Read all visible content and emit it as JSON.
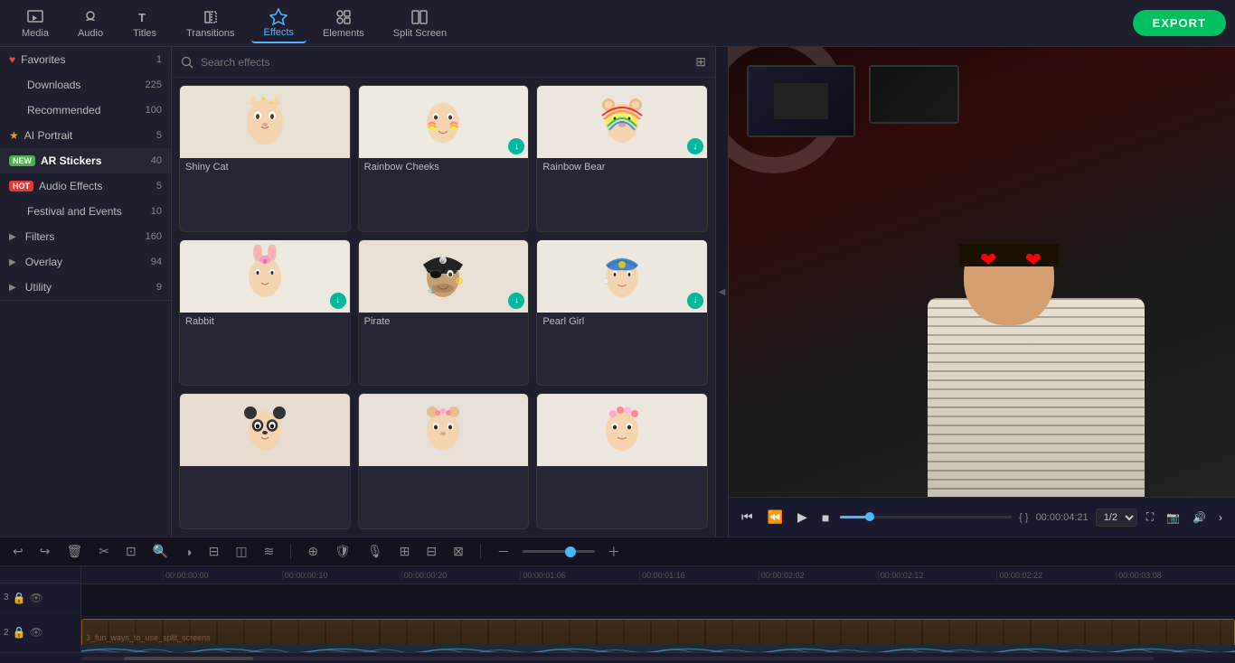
{
  "toolbar": {
    "export_label": "EXPORT",
    "tools": [
      {
        "id": "media",
        "label": "Media",
        "icon": "media"
      },
      {
        "id": "audio",
        "label": "Audio",
        "icon": "audio"
      },
      {
        "id": "titles",
        "label": "Titles",
        "icon": "titles"
      },
      {
        "id": "transitions",
        "label": "Transitions",
        "icon": "transitions"
      },
      {
        "id": "effects",
        "label": "Effects",
        "icon": "effects",
        "active": true
      },
      {
        "id": "elements",
        "label": "Elements",
        "icon": "elements"
      },
      {
        "id": "split_screen",
        "label": "Split Screen",
        "icon": "split"
      }
    ]
  },
  "sidebar": {
    "items": [
      {
        "id": "favorites",
        "label": "Favorites",
        "count": "1",
        "badge": "fav"
      },
      {
        "id": "downloads",
        "label": "Downloads",
        "count": "225"
      },
      {
        "id": "recommended",
        "label": "Recommended",
        "count": "100"
      },
      {
        "id": "ai_portrait",
        "label": "AI Portrait",
        "count": "5",
        "badge": "star"
      },
      {
        "id": "ar_stickers",
        "label": "AR Stickers",
        "count": "40",
        "badge": "new",
        "active": true
      },
      {
        "id": "audio_effects",
        "label": "Audio Effects",
        "count": "5",
        "badge": "hot"
      },
      {
        "id": "festival_events",
        "label": "Festival and Events",
        "count": "10"
      },
      {
        "id": "filters",
        "label": "Filters",
        "count": "160",
        "collapsible": true
      },
      {
        "id": "overlay",
        "label": "Overlay",
        "count": "94",
        "collapsible": true
      },
      {
        "id": "utility",
        "label": "Utility",
        "count": "9",
        "collapsible": true
      }
    ]
  },
  "search": {
    "placeholder": "Search effects",
    "value": ""
  },
  "effects": [
    {
      "id": "shiny_cat",
      "label": "Shiny Cat",
      "has_download": false
    },
    {
      "id": "rainbow_cheeks",
      "label": "Rainbow Cheeks",
      "has_download": true
    },
    {
      "id": "rainbow_bear",
      "label": "Rainbow Bear",
      "has_download": true
    },
    {
      "id": "rabbit",
      "label": "Rabbit",
      "has_download": true
    },
    {
      "id": "pirate",
      "label": "Pirate",
      "has_download": true
    },
    {
      "id": "pearl_girl",
      "label": "Pearl Girl",
      "has_download": true
    },
    {
      "id": "effect7",
      "label": "",
      "has_download": false
    },
    {
      "id": "effect8",
      "label": "",
      "has_download": false
    },
    {
      "id": "effect9",
      "label": "",
      "has_download": false
    }
  ],
  "preview": {
    "time_current": "00:00:04:21",
    "progress_percent": 20,
    "ratio": "1/2"
  },
  "timeline": {
    "ruler_marks": [
      "00:00:00:00",
      "00:00:00:10",
      "00:00:00:20",
      "00:00:01:06",
      "00:00:01:16",
      "00:00:02:02",
      "00:00:02:12",
      "00:00:02:22",
      "00:00:03:08"
    ],
    "tracks": [
      {
        "id": "track1",
        "type": "video",
        "clip_label": "3_fun_ways_to_use_split_screens"
      }
    ]
  },
  "colors": {
    "accent": "#4db8ff",
    "export_bg": "#00c060",
    "ar_badge": "#4CAF50",
    "hot_badge": "#e53935",
    "download_btn": "#00b8a0",
    "active_tab_border": "#4db8ff"
  }
}
